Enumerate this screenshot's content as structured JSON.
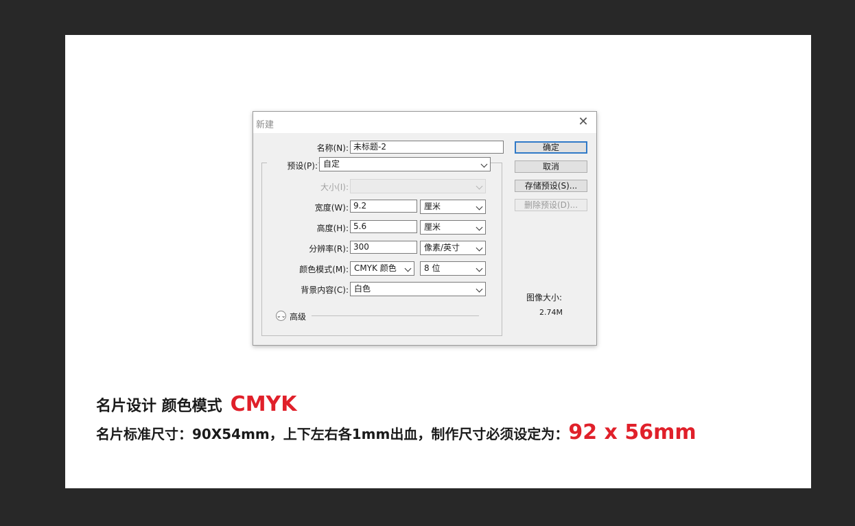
{
  "dialog": {
    "title": "新建",
    "name_label": "名称(N):",
    "name_value": "未标题-2",
    "preset_label": "预设(P):",
    "preset_value": "自定",
    "size_label": "大小(I):",
    "size_value": "",
    "width_label": "宽度(W):",
    "width_value": "9.2",
    "width_unit": "厘米",
    "height_label": "高度(H):",
    "height_value": "5.6",
    "height_unit": "厘米",
    "resolution_label": "分辨率(R):",
    "resolution_value": "300",
    "resolution_unit": "像素/英寸",
    "color_mode_label": "颜色模式(M):",
    "color_mode_value": "CMYK 颜色",
    "bit_depth_value": "8 位",
    "background_label": "背景内容(C):",
    "background_value": "白色",
    "advanced_label": "高级",
    "ok_label": "确定",
    "cancel_label": "取消",
    "save_preset_label": "存储预设(S)...",
    "delete_preset_label": "删除预设(D)...",
    "image_size_label": "图像大小:",
    "image_size_value": "2.74M"
  },
  "caption": {
    "line1_prefix": "名片设计 颜色模式",
    "line1_highlight": "CMYK",
    "line2_prefix": "名片标准尺寸：90X54mm，上下左右各1mm出血，制作尺寸必须设定为：",
    "line2_highlight": "92 x 56mm"
  },
  "colors": {
    "workspace_bg": "#282828",
    "canvas_bg": "#ffffff",
    "highlight_red": "#e0202a",
    "primary_button_border": "#2f79c7"
  },
  "icons": {
    "close": "close-icon",
    "dropdown": "chevron-down-icon",
    "advanced_toggle": "double-chevron-down-icon"
  }
}
